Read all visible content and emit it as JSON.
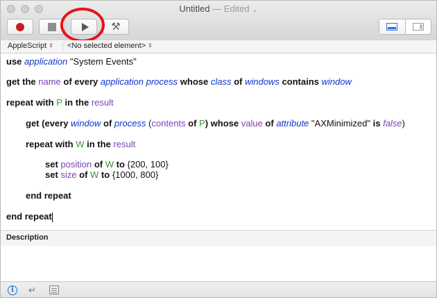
{
  "window": {
    "title": "Untitled",
    "title_status": "— Edited",
    "title_chevron": "⌄"
  },
  "toolbar": {
    "record_icon": "record-icon",
    "stop_icon": "stop-icon",
    "run_icon": "play-icon",
    "compile_icon": "hammer-icon",
    "compile_glyph": "⚒",
    "highlight_color": "#e4141a"
  },
  "navigation": {
    "language": "AppleScript",
    "element": "<No selected element>",
    "updown_glyph": "⇕"
  },
  "script": {
    "line1": {
      "t1": "use ",
      "t2": "application",
      "t3": " \"System Events\""
    },
    "line2": {
      "t1": "get the ",
      "t2": "name",
      "t3": " of every ",
      "t4": "application process",
      "t5": " whose ",
      "t6": "class",
      "t7": " of ",
      "t8": "windows",
      "t9": " contains ",
      "t10": "window"
    },
    "line3": {
      "t1": "repeat with ",
      "t2": "P",
      "t3": " in the ",
      "t4": "result"
    },
    "line4": {
      "t1": "get (every ",
      "t2": "window",
      "t3": " of ",
      "t4": "process",
      "t5": " (",
      "t6": "contents",
      "t7": " of ",
      "t8": "P",
      "t9": ") whose ",
      "t10": "value",
      "t11": " of ",
      "t12": "attribute",
      "t13": " \"AXMinimized\" ",
      "t14": "is",
      "t15": " ",
      "t16": "false",
      "t17": ")"
    },
    "line5": {
      "t1": "repeat with ",
      "t2": "W",
      "t3": " in the ",
      "t4": "result"
    },
    "line6": {
      "t1": "set ",
      "t2": "position",
      "t3": " of ",
      "t4": "W",
      "t5": " to",
      "t6": " {200, 100}"
    },
    "line7": {
      "t1": "set ",
      "t2": "size",
      "t3": " of ",
      "t4": "W",
      "t5": " to",
      "t6": " {1000, 800}"
    },
    "line8": {
      "t1": "end repeat"
    },
    "line9": {
      "t1": "end repeat"
    }
  },
  "description": {
    "title": "Description",
    "body": ""
  },
  "bottombar": {
    "info_glyph": "i",
    "reply_glyph": "↵"
  }
}
